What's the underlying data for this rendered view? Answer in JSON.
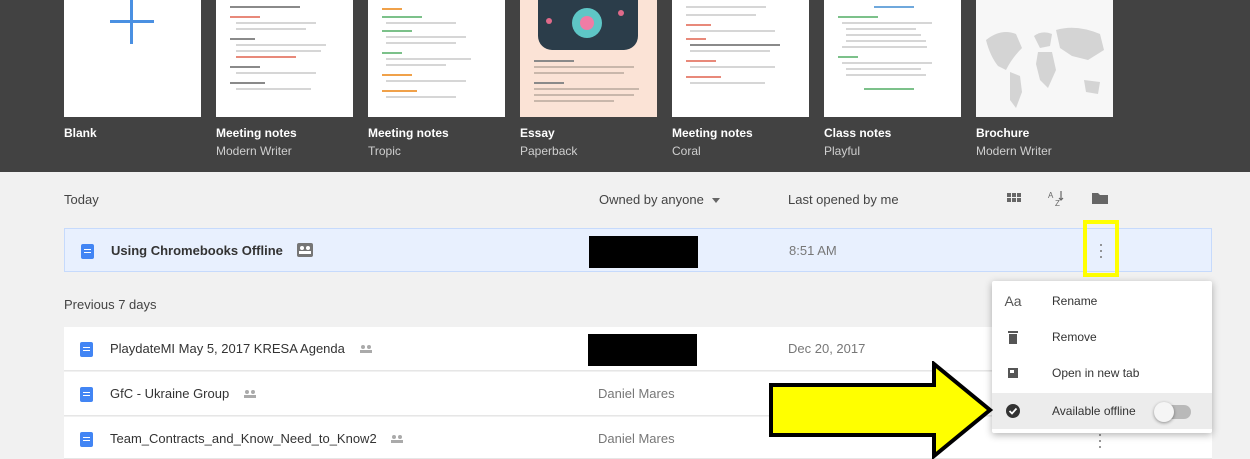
{
  "templates": [
    {
      "name": "Blank",
      "subtitle": ""
    },
    {
      "name": "Meeting notes",
      "subtitle": "Modern Writer"
    },
    {
      "name": "Meeting notes",
      "subtitle": "Tropic"
    },
    {
      "name": "Essay",
      "subtitle": "Paperback"
    },
    {
      "name": "Meeting notes",
      "subtitle": "Coral"
    },
    {
      "name": "Class notes",
      "subtitle": "Playful"
    },
    {
      "name": "Brochure",
      "subtitle": "Modern Writer"
    }
  ],
  "list_header": {
    "section": "Today",
    "owner_filter": "Owned by anyone",
    "sort_label": "Last opened by me",
    "icons": [
      "grid-view-icon",
      "sort-az-icon",
      "folder-icon"
    ]
  },
  "sections": {
    "today": "Today",
    "previous": "Previous 7 days"
  },
  "rows": [
    {
      "title": "Using Chromebooks Offline",
      "owner": "",
      "date": "8:51 AM",
      "owner_redacted": true
    },
    {
      "title": "PlaydateMI May 5, 2017 KRESA Agenda",
      "owner": "",
      "date": "Dec 20, 2017",
      "owner_redacted": true
    },
    {
      "title": "GfC - Ukraine Group",
      "owner": "Daniel Mares",
      "date": ""
    },
    {
      "title": "Team_Contracts_and_Know_Need_to_Know2",
      "owner": "Daniel Mares",
      "date": ""
    }
  ],
  "menu": {
    "items": [
      {
        "icon": "Aa",
        "label": "Rename"
      },
      {
        "icon": "trash-icon",
        "label": "Remove"
      },
      {
        "icon": "open-new-tab-icon",
        "label": "Open in new tab"
      },
      {
        "icon": "offline-check-icon",
        "label": "Available offline",
        "toggle": false
      }
    ]
  },
  "colors": {
    "gallery_bg": "#424242",
    "doc_blue": "#4285f4",
    "highlight": "#ffff00"
  }
}
